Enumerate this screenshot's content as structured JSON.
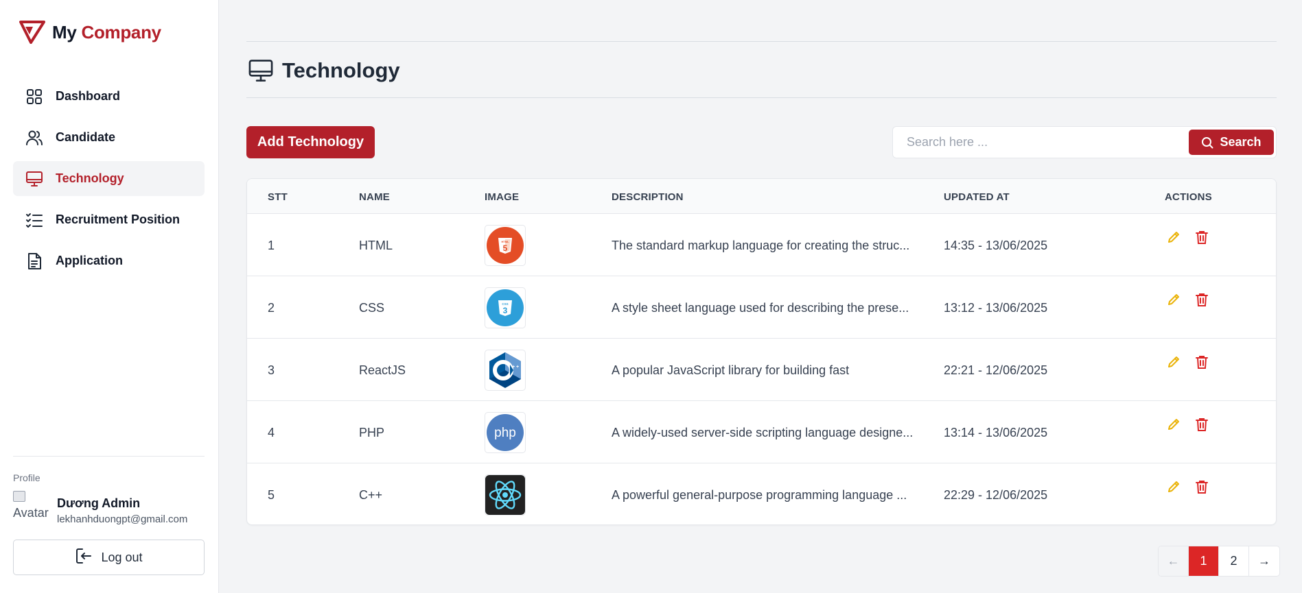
{
  "brand": {
    "part1": "My",
    "part2": "Company",
    "accent": "#b3202a"
  },
  "nav": [
    {
      "label": "Dashboard",
      "icon": "grid-icon"
    },
    {
      "label": "Candidate",
      "icon": "users-icon"
    },
    {
      "label": "Technology",
      "icon": "monitor-icon",
      "active": true
    },
    {
      "label": "Recruitment Position",
      "icon": "checklist-icon"
    },
    {
      "label": "Application",
      "icon": "document-icon"
    }
  ],
  "profile": {
    "caption": "Profile",
    "avatar_alt": "Avatar",
    "name": "Dương Admin",
    "email": "lekhanhduongpt@gmail.com",
    "logout_label": "Log out"
  },
  "page": {
    "title": "Technology",
    "icon": "monitor-icon"
  },
  "toolbar": {
    "add_label": "Add Technology",
    "search_placeholder": "Search here ...",
    "search_label": "Search"
  },
  "table": {
    "headers": [
      "STT",
      "NAME",
      "IMAGE",
      "DESCRIPTION",
      "UPDATED AT",
      "ACTIONS"
    ],
    "rows": [
      {
        "stt": "1",
        "name": "HTML",
        "image": "html5-logo",
        "description": "The standard markup language for creating the struc...",
        "updated_at": "14:35 - 13/06/2025"
      },
      {
        "stt": "2",
        "name": "CSS",
        "image": "css3-logo",
        "description": "A style sheet language used for describing the prese...",
        "updated_at": "13:12 - 13/06/2025"
      },
      {
        "stt": "3",
        "name": "ReactJS",
        "image": "cpp-logo",
        "description": "A popular JavaScript library for building fast",
        "updated_at": "22:21 - 12/06/2025"
      },
      {
        "stt": "4",
        "name": "PHP",
        "image": "php-logo",
        "description": "A widely-used server-side scripting language designe...",
        "updated_at": "13:14 - 13/06/2025"
      },
      {
        "stt": "5",
        "name": "C++",
        "image": "react-logo",
        "description": "A powerful general-purpose programming language ...",
        "updated_at": "22:29 - 12/06/2025"
      }
    ]
  },
  "pagination": {
    "prev": "←",
    "pages": [
      "1",
      "2"
    ],
    "current": "1",
    "next": "→"
  },
  "colors": {
    "edit": "#eab308",
    "delete": "#dc2626",
    "pager_current": "#dc2626"
  }
}
